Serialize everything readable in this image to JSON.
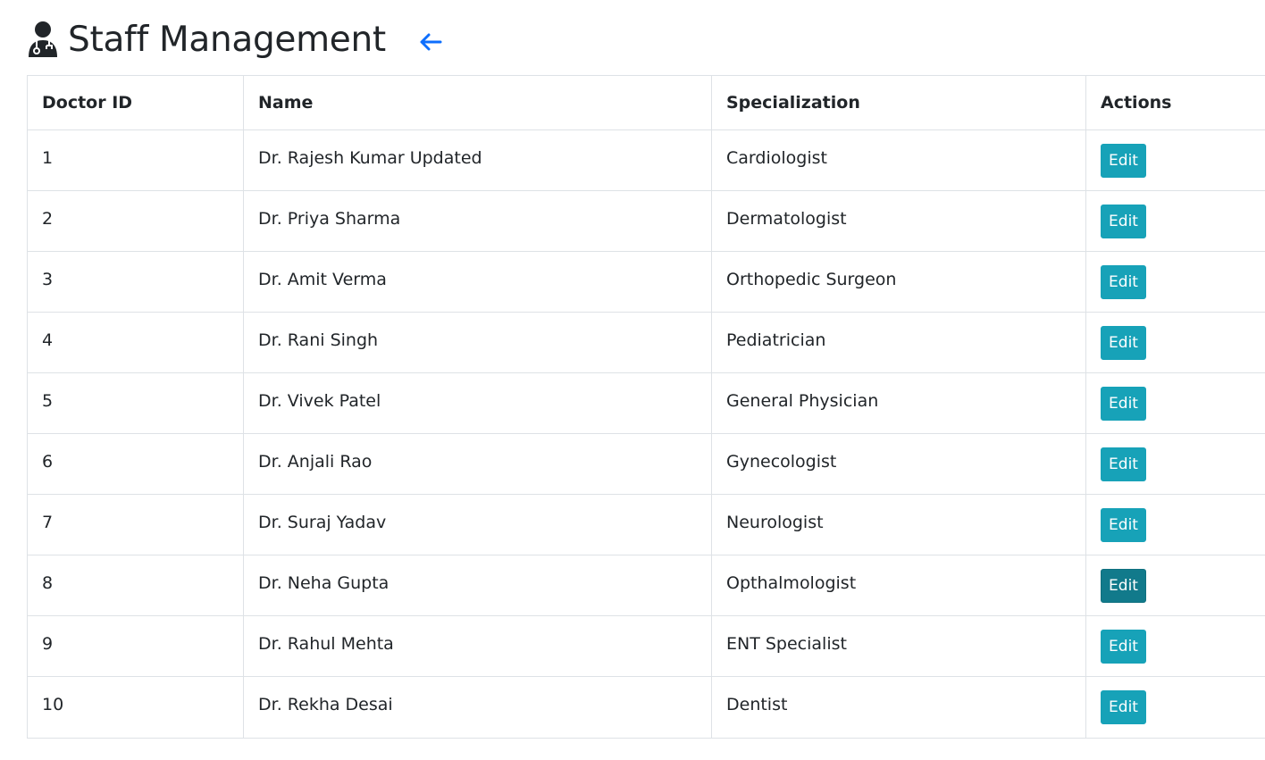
{
  "header": {
    "title": "Staff Management",
    "title_icon": "user-doctor-icon",
    "back_icon": "arrow-left-icon",
    "accent_color": "#0d6efd"
  },
  "table": {
    "columns": [
      "Doctor ID",
      "Name",
      "Specialization",
      "Actions"
    ],
    "rows": [
      {
        "id": "1",
        "name": "Dr. Rajesh Kumar Updated",
        "specialization": "Cardiologist",
        "action": "Edit"
      },
      {
        "id": "2",
        "name": "Dr. Priya Sharma",
        "specialization": "Dermatologist",
        "action": "Edit"
      },
      {
        "id": "3",
        "name": "Dr. Amit Verma",
        "specialization": "Orthopedic Surgeon",
        "action": "Edit"
      },
      {
        "id": "4",
        "name": "Dr. Rani Singh",
        "specialization": "Pediatrician",
        "action": "Edit"
      },
      {
        "id": "5",
        "name": "Dr. Vivek Patel",
        "specialization": "General Physician",
        "action": "Edit"
      },
      {
        "id": "6",
        "name": "Dr. Anjali Rao",
        "specialization": "Gynecologist",
        "action": "Edit"
      },
      {
        "id": "7",
        "name": "Dr. Suraj Yadav",
        "specialization": "Neurologist",
        "action": "Edit"
      },
      {
        "id": "8",
        "name": "Dr. Neha Gupta",
        "specialization": "Opthalmologist",
        "action": "Edit"
      },
      {
        "id": "9",
        "name": "Dr. Rahul Mehta",
        "specialization": "ENT Specialist",
        "action": "Edit"
      },
      {
        "id": "10",
        "name": "Dr. Rekha Desai",
        "specialization": "Dentist",
        "action": "Edit"
      }
    ],
    "button_color": "#17a2b8",
    "button_hover_color": "#117a8b"
  }
}
